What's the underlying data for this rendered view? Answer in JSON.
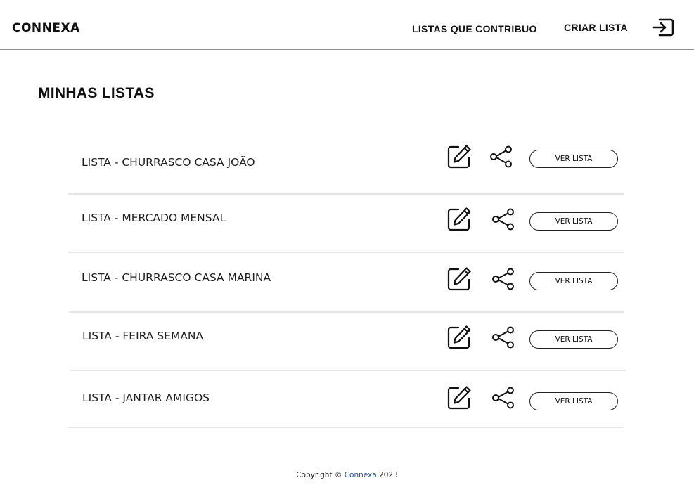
{
  "header": {
    "logo": "CONNEXA",
    "nav_contributed": "LISTAS QUE CONTRIBUO",
    "nav_create": "CRIAR LISTA",
    "logout_icon": "logout-icon"
  },
  "main": {
    "title": "MINHAS LISTAS",
    "view_label": "VER LISTA",
    "lists": [
      {
        "name": "LISTA - CHURRASCO CASA JOÃO"
      },
      {
        "name": "LISTA - MERCADO MENSAL"
      },
      {
        "name": "LISTA - CHURRASCO CASA MARINA"
      },
      {
        "name": "LISTA - FEIRA SEMANA"
      },
      {
        "name": "LISTA - JANTAR AMIGOS"
      }
    ]
  },
  "footer": {
    "prefix": "Copyright ©",
    "brand": "Connexa",
    "year": "2023",
    "brand_color": "#1d4c8c"
  },
  "colors": {
    "header_border": "#8f8f8f",
    "row_divider": "#e6e6e6"
  }
}
